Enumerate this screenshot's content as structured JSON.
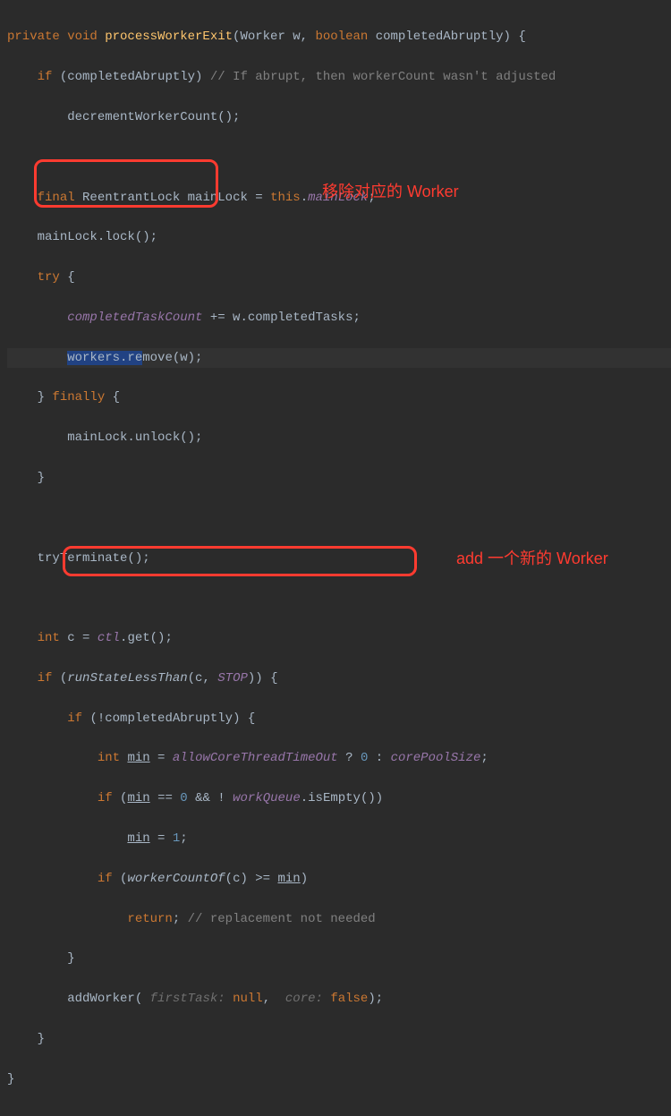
{
  "code": {
    "l1_kw1": "private void ",
    "l1_method": "processWorkerExit",
    "l1_paren": "(Worker w, ",
    "l1_kw2": "boolean ",
    "l1_param2": "completedAbruptly) {",
    "l2_kw": "if ",
    "l2_cond": "(completedAbruptly) ",
    "l2_comment": "// If abrupt, then workerCount wasn't adjusted",
    "l3": "decrementWorkerCount();",
    "l5_kw": "final ",
    "l5_type": "ReentrantLock ",
    "l5_var": "mainLock = ",
    "l5_this": "this",
    "l5_dot": ".",
    "l5_field": "mainLock",
    "l5_semi": ";",
    "l6": "mainLock.lock();",
    "l7_kw": "try ",
    "l7_brace": "{",
    "l8_field": "completedTaskCount",
    "l8_op": " += w.completedTasks;",
    "l9_sel": "workers.re",
    "l9_rest": "move(w);",
    "l10_brace": "} ",
    "l10_kw": "finally ",
    "l10_brace2": "{",
    "l11": "mainLock.unlock();",
    "l12": "}",
    "l14": "tryTerminate();",
    "l16_kw": "int ",
    "l16_rest": "c = ",
    "l16_field": "ctl",
    "l16_call": ".get();",
    "l17_kw": "if ",
    "l17_open": "(",
    "l17_call": "runStateLessThan",
    "l17_args": "(c, ",
    "l17_stop": "STOP",
    "l17_close": ")) {",
    "l18_kw": "if ",
    "l18_cond": "(!completedAbruptly) {",
    "l19_kw": "int ",
    "l19_var": "min",
    "l19_eq": " = ",
    "l19_field": "allowCoreThreadTimeOut",
    "l19_tern": " ? ",
    "l19_zero": "0",
    "l19_colon": " : ",
    "l19_field2": "corePoolSize",
    "l19_semi": ";",
    "l20_kw": "if ",
    "l20_open": "(",
    "l20_var": "min",
    "l20_eq": " == ",
    "l20_zero": "0",
    "l20_and": " && ! ",
    "l20_field": "workQueue",
    "l20_call": ".isEmpty())",
    "l21_var": "min",
    "l21_eq": " = ",
    "l21_one": "1",
    "l21_semi": ";",
    "l22_kw": "if ",
    "l22_open": "(",
    "l22_call": "workerCountOf",
    "l22_args": "(c) >= ",
    "l22_var": "min",
    "l22_close": ")",
    "l23_kw": "return",
    "l23_semi": "; ",
    "l23_comment": "// replacement not needed",
    "l24": "}",
    "l25_call": "addWorker",
    "l25_open": "( ",
    "l25_hint1": "firstTask: ",
    "l25_val1": "null",
    "l25_comma": ",  ",
    "l25_hint2": "core: ",
    "l25_val2": "false",
    "l25_close": ");",
    "l26": "}",
    "l27": "}"
  },
  "annotations": {
    "a1": "移除对应的 Worker",
    "a2": "add 一个新的 Worker"
  }
}
